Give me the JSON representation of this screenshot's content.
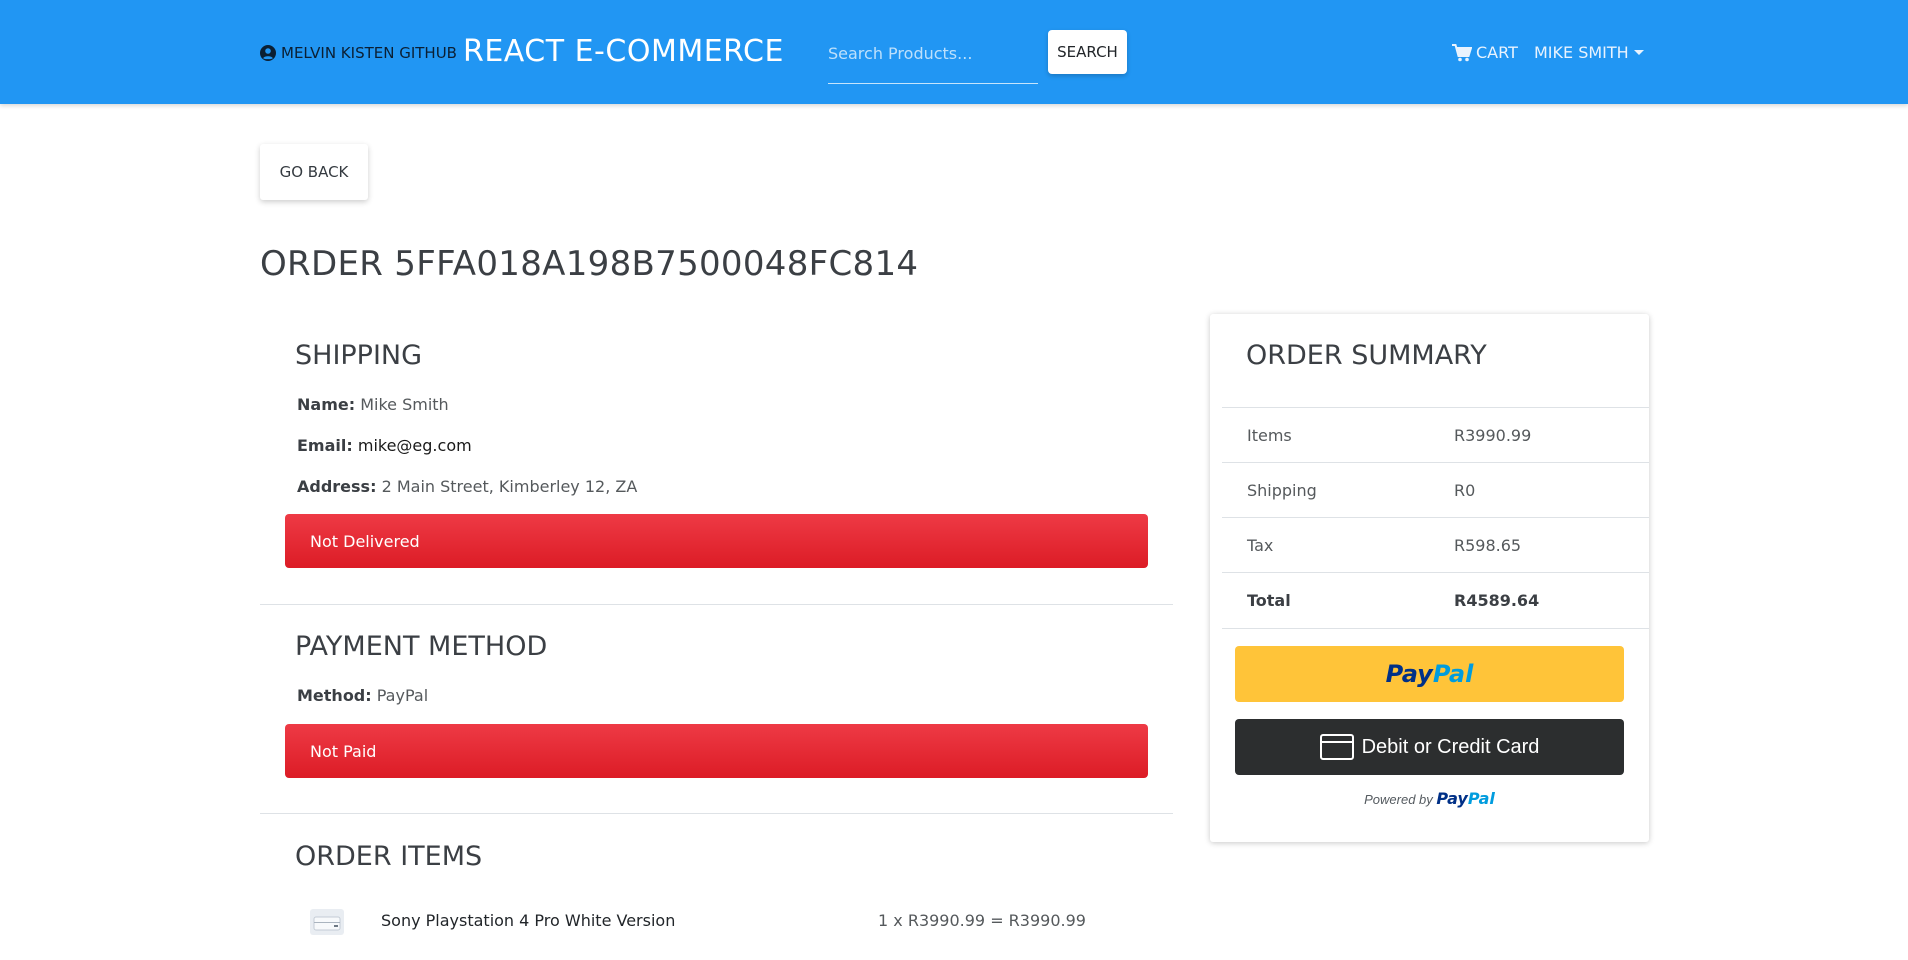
{
  "navbar": {
    "github_link": "MELVIN KISTEN GITHUB",
    "brand": "REACT E-COMMERCE",
    "search_placeholder": "Search Products...",
    "search_button": "SEARCH",
    "cart_label": "CART",
    "user_name": "MIKE SMITH",
    "color": "#2196f3"
  },
  "back_button": "GO BACK",
  "order_title": "ORDER 5FFA018A198B7500048FC814",
  "shipping": {
    "title": "SHIPPING",
    "name_label": "Name:",
    "name": "Mike Smith",
    "email_label": "Email:",
    "email": "mike@eg.com",
    "address_label": "Address:",
    "address": "2 Main Street, Kimberley 12, ZA",
    "status": "Not Delivered"
  },
  "payment": {
    "title": "PAYMENT METHOD",
    "method_label": "Method:",
    "method": "PayPal",
    "status": "Not Paid"
  },
  "order_items": {
    "title": "ORDER ITEMS",
    "items": [
      {
        "name": "Sony Playstation 4 Pro White Version",
        "calc": "1 x R3990.99 = R3990.99"
      }
    ]
  },
  "summary": {
    "title": "ORDER SUMMARY",
    "rows": [
      {
        "label": "Items",
        "value": "R3990.99"
      },
      {
        "label": "Shipping",
        "value": "R0"
      },
      {
        "label": "Tax",
        "value": "R598.65"
      },
      {
        "label": "Total",
        "value": "R4589.64"
      }
    ],
    "paypal_button": {
      "part1": "Pay",
      "part2": "Pal"
    },
    "card_button": "Debit or Credit Card",
    "powered_by": "Powered by",
    "powered_logo": {
      "part1": "Pay",
      "part2": "Pal"
    }
  },
  "colors": {
    "alert_red": "#e4252f",
    "paypal_yellow": "#ffc439",
    "card_dark": "#2c2e2f"
  }
}
